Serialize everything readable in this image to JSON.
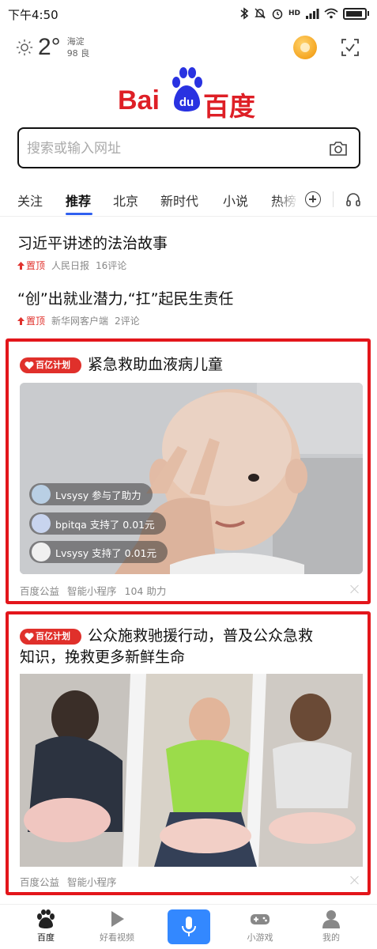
{
  "status_bar": {
    "time": "下午4:50",
    "network_label": "HD",
    "signal": "4G"
  },
  "weather": {
    "temperature": "2°",
    "location": "海淀",
    "aqi_value": "98",
    "aqi_level": "良"
  },
  "logo": {
    "latin": "Bai",
    "paw_text": "du",
    "chinese": "百度"
  },
  "search": {
    "placeholder": "搜索或输入网址"
  },
  "tabs": [
    {
      "label": "关注",
      "active": false
    },
    {
      "label": "推荐",
      "active": true
    },
    {
      "label": "北京",
      "active": false
    },
    {
      "label": "新时代",
      "active": false
    },
    {
      "label": "小说",
      "active": false
    },
    {
      "label": "热榜",
      "active": false
    }
  ],
  "news": [
    {
      "title": "习近平讲述的法治故事",
      "pin_label": "置顶",
      "source": "人民日报",
      "comments": "16评论"
    },
    {
      "title": "“创”出就业潜力,“扛”起民生责任",
      "pin_label": "置顶",
      "source": "新华网客户端",
      "comments": "2评论"
    }
  ],
  "cards": [
    {
      "badge": "百亿计划",
      "title": "紧急救助血液病儿童",
      "bubbles": [
        {
          "text": "Lvsysy 参与了助力"
        },
        {
          "text": "bpitqa 支持了 0.01元"
        },
        {
          "text": "Lvsysy 支持了 0.01元"
        }
      ],
      "meta": [
        "百度公益",
        "智能小程序",
        "104 助力"
      ]
    },
    {
      "badge": "百亿计划",
      "title_line1": "公众施救驰援行动，普及公众急救",
      "title_line2": "知识，挽救更多新鲜生命",
      "meta": [
        "百度公益",
        "智能小程序"
      ]
    }
  ],
  "bottom_nav": [
    {
      "label": "百度",
      "icon": "baidu-paw-icon",
      "active": true
    },
    {
      "label": "好看视频",
      "icon": "play-icon",
      "active": false
    },
    {
      "label": "",
      "icon": "microphone-icon",
      "active": false
    },
    {
      "label": "小游戏",
      "icon": "gamepad-icon",
      "active": false
    },
    {
      "label": "我的",
      "icon": "user-icon",
      "active": false
    }
  ],
  "colors": {
    "brand_red": "#de1f26",
    "card_border": "#e3161b",
    "tab_accent": "#3060f0",
    "mic_blue": "#3388ff"
  }
}
